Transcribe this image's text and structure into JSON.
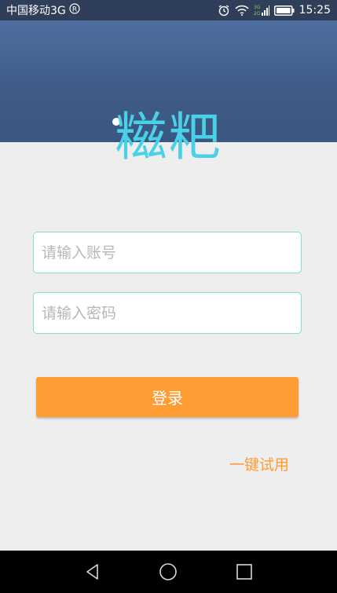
{
  "status_bar": {
    "carrier": "中国移动3G",
    "time": "15:25"
  },
  "header": {
    "logo_text": "糍粑"
  },
  "form": {
    "account_placeholder": "请输入账号",
    "password_placeholder": "请输入密码",
    "login_label": "登录",
    "try_label": "一键试用"
  },
  "colors": {
    "accent_orange": "#ff9c34",
    "field_border": "#7ee3c7",
    "logo_color": "#4ad0e8",
    "header_blue": "#4a6797"
  },
  "nav_bar": {
    "icons": [
      "back-icon",
      "home-icon",
      "recents-icon"
    ]
  }
}
